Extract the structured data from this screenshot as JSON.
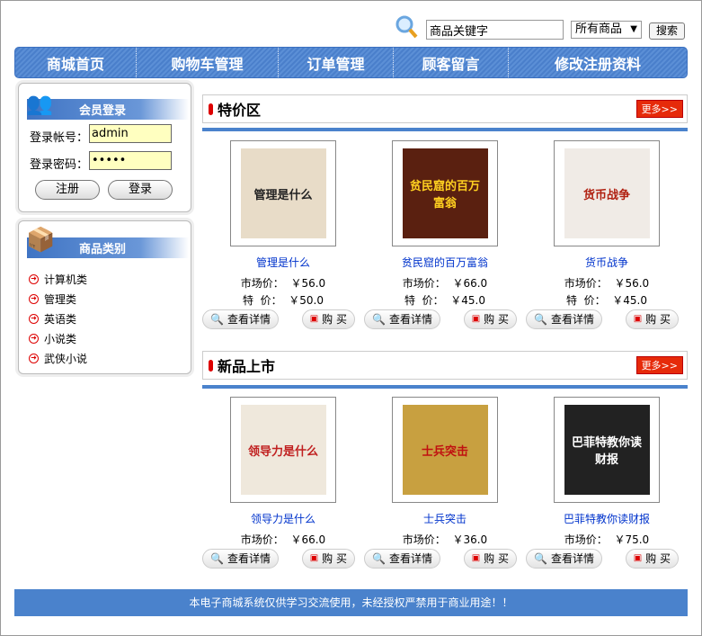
{
  "search": {
    "value": "商品关键字",
    "select": "所有商品",
    "button": "搜索"
  },
  "nav": [
    "商城首页",
    "购物车管理",
    "订单管理",
    "顾客留言",
    "修改注册资料"
  ],
  "login": {
    "title": "会员登录",
    "user_label": "登录帐号：",
    "user_value": "admin",
    "pass_label": "登录密码：",
    "pass_value": "•••••",
    "register": "注册",
    "login": "登录"
  },
  "categories": {
    "title": "商品类别",
    "items": [
      "计算机类",
      "管理类",
      "英语类",
      "小说类",
      "武侠小说"
    ]
  },
  "labels": {
    "market": "市场价：",
    "special": "特  价：",
    "detail": "查看详情",
    "buy": "购 买",
    "more": "更多>>"
  },
  "specials": {
    "title": "特价区",
    "items": [
      {
        "name": "管理是什么",
        "market": "￥56.0",
        "special": "￥50.0",
        "cover": "管理是什么",
        "color": "#e8dcc8",
        "fg": "#222"
      },
      {
        "name": "贫民窟的百万富翁",
        "market": "￥66.0",
        "special": "￥45.0",
        "cover": "贫民窟的百万富翁",
        "color": "#5a2010",
        "fg": "#ffd020"
      },
      {
        "name": "货币战争",
        "market": "￥56.0",
        "special": "￥45.0",
        "cover": "货币战争",
        "color": "#f0ebe6",
        "fg": "#b02010"
      }
    ]
  },
  "newitems": {
    "title": "新品上市",
    "items": [
      {
        "name": "领导力是什么",
        "market": "￥66.0",
        "cover": "领导力是什么",
        "color": "#efe8dc",
        "fg": "#c02020"
      },
      {
        "name": "士兵突击",
        "market": "￥36.0",
        "cover": "士兵突击",
        "color": "#c8a040",
        "fg": "#c01010"
      },
      {
        "name": "巴菲特教你读财报",
        "market": "￥75.0",
        "cover": "巴菲特教你读财报",
        "color": "#222",
        "fg": "#fff"
      }
    ]
  },
  "footer": "本电子商城系统仅供学习交流使用，未经授权严禁用于商业用途！！"
}
